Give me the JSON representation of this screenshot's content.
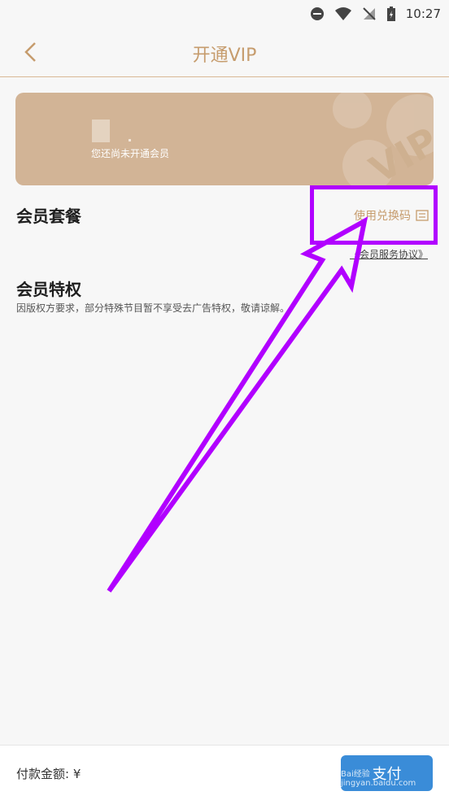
{
  "status_bar": {
    "time": "10:27",
    "icons": [
      "dnd-icon",
      "wifi-icon",
      "no-signal-icon",
      "battery-charging-icon"
    ]
  },
  "header": {
    "title": "开通VIP",
    "back_icon": "chevron-left-icon"
  },
  "vip_card": {
    "status_text": "您还尚未开通会员",
    "watermark": "VIP",
    "bg_color": "#d2b496"
  },
  "package": {
    "title": "会员套餐",
    "redeem_label": "使用兑换码",
    "redeem_icon": "ticket-icon",
    "agreement_link": "《会员服务协议》"
  },
  "privileges": {
    "title": "会员特权",
    "notice": "因版权方要求，部分特殊节目暂不享受去广告特权，敬请谅解。"
  },
  "footer": {
    "amount_label": "付款金额: ¥",
    "pay_button": "支付",
    "watermark": "Bai经验 jingyan.baidu.com"
  },
  "colors": {
    "accent": "#c69c6d",
    "annotation": "#b100ff",
    "pay_button": "#3a8cd8"
  }
}
